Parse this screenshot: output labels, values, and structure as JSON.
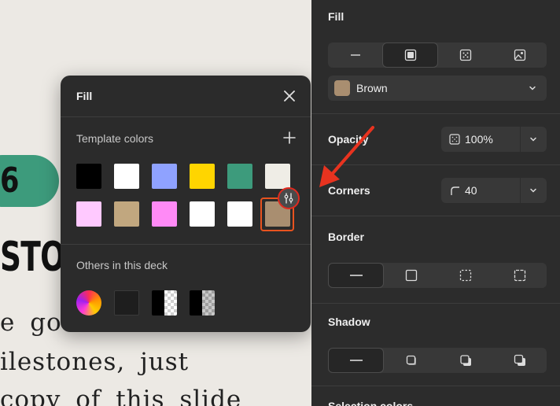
{
  "canvas": {
    "number": "6",
    "heading": "STOR",
    "lines": [
      "e  got",
      "ilestones,  just",
      "copy  of  this  slide"
    ]
  },
  "fill_popover": {
    "title": "Fill",
    "template_label": "Template colors",
    "others_label": "Others in this deck",
    "template_colors": [
      "#000000",
      "#ffffff",
      "#8fa2ff",
      "#ffd500",
      "#3d9b7c",
      "#efede6",
      "#ffc9ff",
      "#c1a77f",
      "#ff8af6",
      "#ffffff",
      "#ffffff",
      "#a98e70"
    ],
    "selected_color": "#a98e70",
    "accent": "#e8531f"
  },
  "panel": {
    "fill": {
      "title": "Fill",
      "color_name": "Brown",
      "color_hex": "#a98e70",
      "types": [
        "none-icon",
        "solid-icon",
        "gradient-icon",
        "image-icon"
      ],
      "active_index": 1
    },
    "opacity": {
      "label": "Opacity",
      "value": "100%"
    },
    "corners": {
      "label": "Corners",
      "value": "40"
    },
    "border": {
      "title": "Border",
      "styles": [
        "solid-line-icon",
        "square-icon",
        "dashed-square-icon",
        "dashed-square-fine-icon"
      ],
      "active_index": 0
    },
    "shadow": {
      "title": "Shadow",
      "styles": [
        "none-icon",
        "shadow-small-icon",
        "shadow-medium-icon",
        "shadow-large-icon"
      ],
      "active_index": 0
    },
    "selection": {
      "title": "Selection colors"
    }
  },
  "colors": {
    "panel_bg": "#2c2c2c",
    "popover_bg": "#2b2b2b",
    "highlight": "#e02a1f"
  }
}
